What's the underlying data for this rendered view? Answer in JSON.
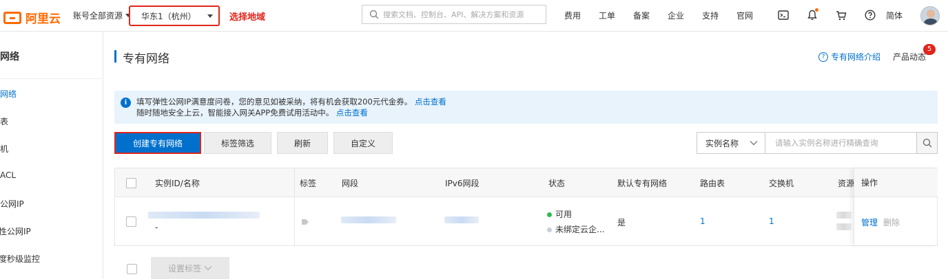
{
  "topbar": {
    "logo_text": "阿里云",
    "account_label": "账号全部资源",
    "region_label": "华东1（杭州）",
    "region_note": "选择地域",
    "search_placeholder": "搜索文档、控制台、API、解决方案和资源",
    "nav_links": [
      "费用",
      "工单",
      "备案",
      "企业",
      "支持",
      "官网"
    ],
    "icons": [
      "terminal-icon",
      "bell-icon",
      "cart-icon",
      "help-icon"
    ],
    "language": "简体"
  },
  "sidebar": {
    "title": "网络",
    "items": [
      "网络",
      "表",
      "机",
      "ACL",
      "公网IP",
      "弹性公网IP",
      "宽度秒级监控"
    ],
    "active_index": 0
  },
  "page": {
    "title": "专有网络",
    "intro_link": "专有网络介绍",
    "product_news": "产品动态",
    "news_badge": "5"
  },
  "notice": {
    "line1": "填写弹性公网IP满意度问卷，您的意见如被采纳，将有机会获取200元代金券。",
    "line1_link": "点击查看",
    "line2": "随时随地安全上云，智能接入网关APP免费试用活动中。",
    "line2_link": "点击查看"
  },
  "toolbar": {
    "create_label": "创建专有网络",
    "tag_filter_label": "标签筛选",
    "refresh_label": "刷新",
    "customize_label": "自定义",
    "filter_select": "实例名称",
    "filter_placeholder": "请输入实例名称进行精确查询"
  },
  "table": {
    "columns": [
      "实例ID/名称",
      "标签",
      "网段",
      "IPv6网段",
      "状态",
      "默认专有网络",
      "路由表",
      "交换机",
      "资源",
      "操作"
    ],
    "row": {
      "name_suffix": "-",
      "status_available": "可用",
      "status_unbound": "未绑定云企...",
      "default_vpc": "是",
      "route_tables": "1",
      "vswitches": "1",
      "action_manage": "管理",
      "action_delete": "删除"
    }
  },
  "footer": {
    "set_tags_label": "设置标签"
  },
  "colors": {
    "primary": "#0070cc",
    "brand": "#ff6a00",
    "highlight": "#e1251b",
    "available": "#2ebc4f"
  }
}
